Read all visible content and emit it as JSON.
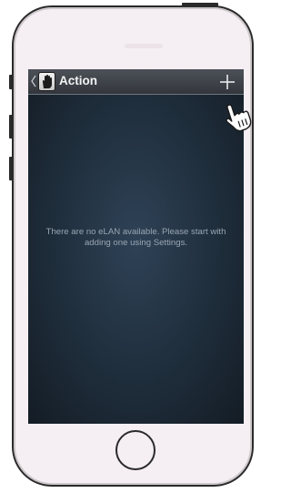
{
  "app_bar": {
    "title": "Action",
    "back_icon": "chevron-left-icon",
    "app_icon": "hand-icon",
    "add_icon": "plus-icon"
  },
  "main": {
    "empty_message": "There are no eLAN available. Please start with adding one using Settings."
  },
  "device": {
    "home_button": "home-button"
  },
  "colors": {
    "screen_background": "#1f2d3b",
    "bar_background": "#3f444b",
    "message_text": "#9aa6b2"
  }
}
